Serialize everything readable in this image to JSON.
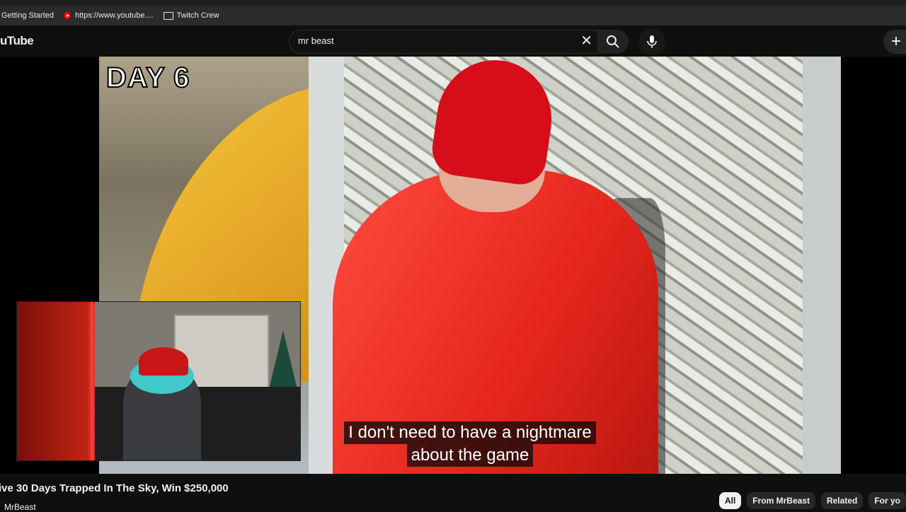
{
  "bookmarks": [
    {
      "label": "Getting Started",
      "icon": "bookmark-icon"
    },
    {
      "label": "https://www.youtube....",
      "icon": "youtube-icon"
    },
    {
      "label": "Twitch Crew",
      "icon": "folder-icon"
    }
  ],
  "header": {
    "logo_text": "uTube",
    "search_value": "mr beast",
    "clear_icon": "close-icon",
    "search_icon": "search-icon",
    "mic_icon": "microphone-icon",
    "create_icon": "plus-icon"
  },
  "video": {
    "overlay_text": "DAY 6",
    "captions": [
      "I don't need to have a nightmare",
      "about the game"
    ]
  },
  "below": {
    "title": "ive 30 Days Trapped In The Sky, Win $250,000",
    "channel": "MrBeast"
  },
  "chips": [
    {
      "label": "All",
      "active": true
    },
    {
      "label": "From MrBeast",
      "active": false
    },
    {
      "label": "Related",
      "active": false
    },
    {
      "label": "For yo",
      "active": false
    }
  ],
  "colors": {
    "background": "#0f0f0f",
    "accent_red": "#ff0000",
    "chip_bg": "#272727"
  }
}
